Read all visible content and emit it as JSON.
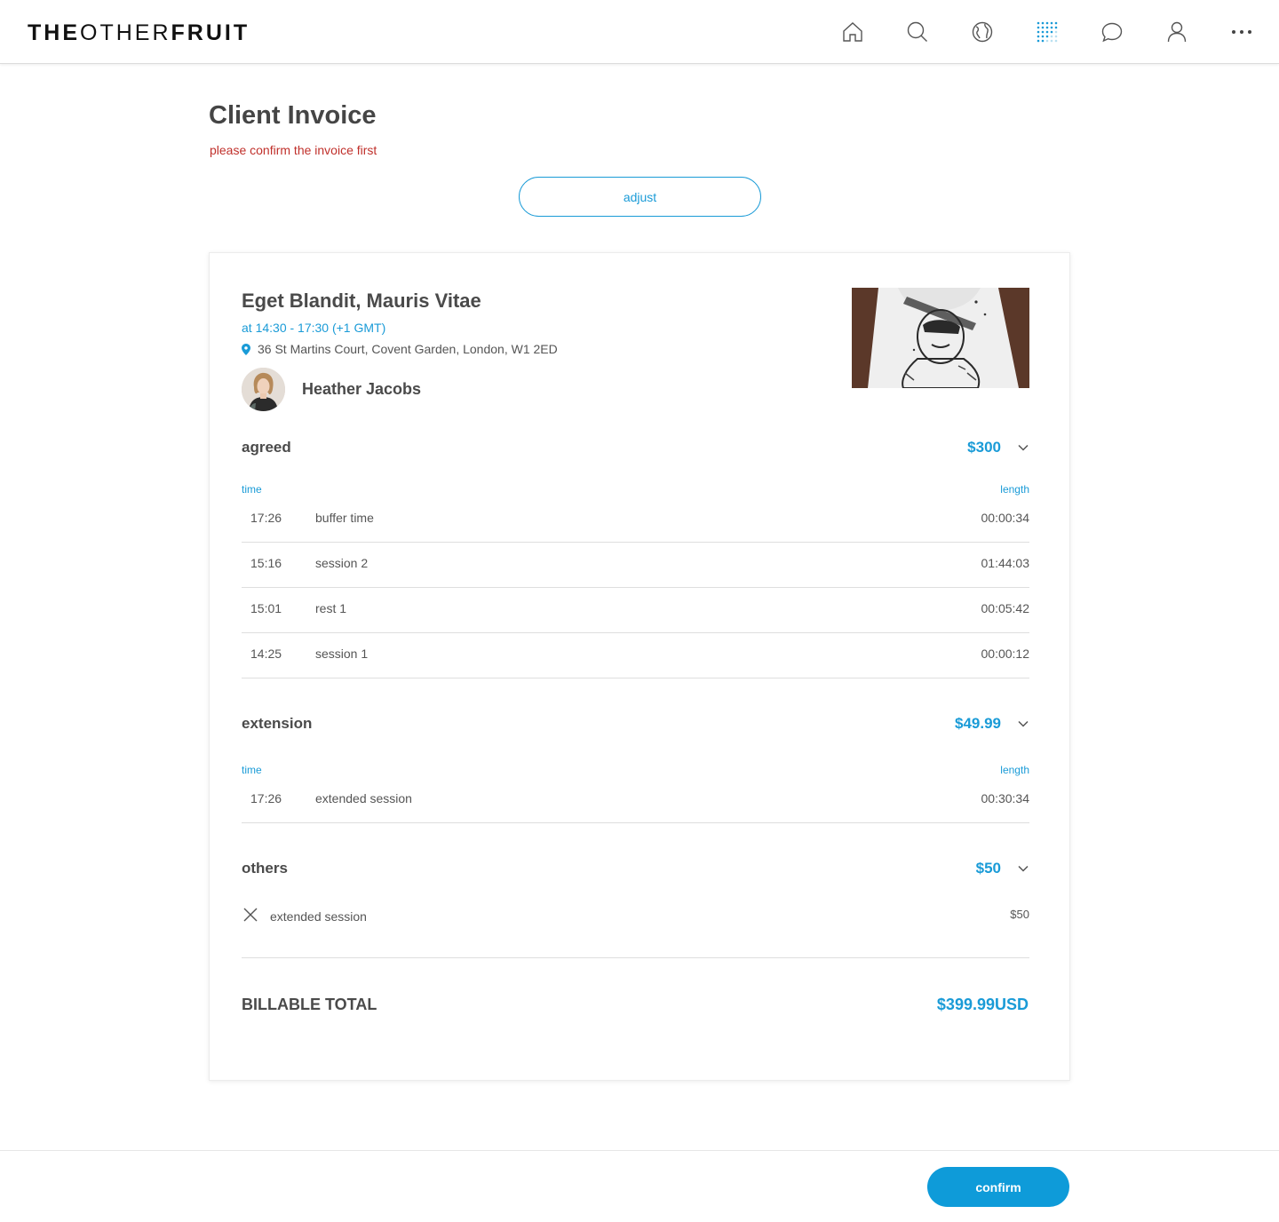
{
  "header": {
    "logo_bold_1": "THE",
    "logo_light": "OTHER",
    "logo_bold_2": "FRUIT",
    "nav_icons": [
      "home-icon",
      "search-icon",
      "globe-icon",
      "dots-grid-icon",
      "chat-icon",
      "user-icon",
      "more-icon"
    ]
  },
  "page": {
    "title": "Client Invoice",
    "warning": "please confirm the invoice first",
    "adjust_label": "adjust"
  },
  "event": {
    "title": "Eget Blandit, Mauris Vitae",
    "time": "at 14:30 - 17:30 (+1 GMT)",
    "location": "36 St Martins Court, Covent Garden, London, W1 2ED",
    "artist": "Heather Jacobs"
  },
  "agreed": {
    "title": "agreed",
    "amount": "$300",
    "col_time": "time",
    "col_length": "length",
    "rows": [
      {
        "time": "17:26",
        "name": "buffer time",
        "length": "00:00:34"
      },
      {
        "time": "15:16",
        "name": "session 2",
        "length": "01:44:03"
      },
      {
        "time": "15:01",
        "name": "rest 1",
        "length": "00:05:42"
      },
      {
        "time": "14:25",
        "name": "session 1",
        "length": "00:00:12"
      }
    ]
  },
  "extension": {
    "title": "extension",
    "amount": "$49.99",
    "col_time": "time",
    "col_length": "length",
    "rows": [
      {
        "time": "17:26",
        "name": "extended session",
        "length": "00:30:34"
      }
    ]
  },
  "others": {
    "title": "others",
    "amount": "$50",
    "items": [
      {
        "name": "extended session",
        "value": "$50"
      }
    ]
  },
  "total": {
    "label": "BILLABLE TOTAL",
    "value": "$399.99USD"
  },
  "footer": {
    "confirm_label": "confirm"
  },
  "colors": {
    "accent": "#1a9bd7",
    "warning": "#c0302b",
    "confirm_bg": "#0e9bd9"
  }
}
